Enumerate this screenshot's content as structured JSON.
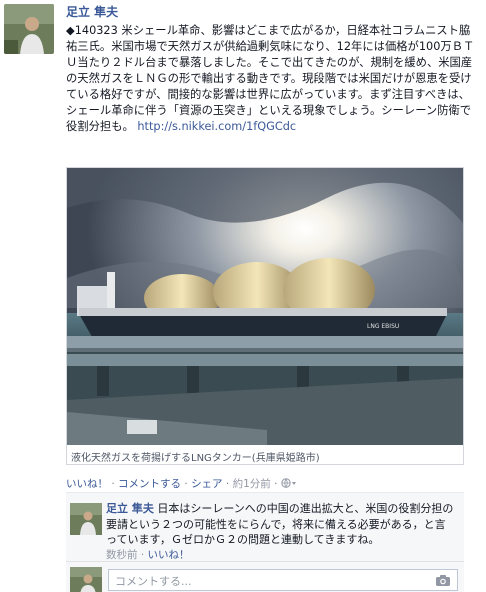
{
  "post": {
    "author": "足立 隼夫",
    "text": "◆140323 米シェール革命、影響はどこまで広がるか，日経本社コラムニスト脇祐三氏。米国市場で天然ガスが供給過剰気味になり、12年には価格が100万ＢＴＵ当たり２ドル台まで暴落しました。そこで出てきたのが、規制を緩め、米国産の天然ガスをＬＮＧの形で輸出する動きです。現段階では米国だけが恩恵を受けている格好ですが、間接的な影響は世界に広がっています。まず注目すべきは、シェール革命に伴う「資源の玉突き」といえる現象でしょう。シーレーン防衛で役割分担も。",
    "link": "http://s.nikkei.com/1fQGCdc",
    "photo_caption": "液化天然ガスを荷揚げするLNGタンカー(兵庫県姫路市)",
    "ship_name": "LNG EBISU"
  },
  "actions": {
    "like": "いいね！",
    "comment": "コメントする",
    "share": "シェア",
    "time": "約1分前",
    "separator": "·"
  },
  "comment": {
    "author": "足立 隼夫",
    "text": "日本はシーレーンへの中国の進出拡大と、米国の役割分担の要請という２つの可能性をにらんで，将来に備える必要がある，と言っています，ＧゼロかＧ２の問題と連動してきますね。",
    "time": "数秒前",
    "like": "いいね！"
  },
  "reply": {
    "placeholder": "コメントする..."
  },
  "colors": {
    "link": "#3b5998",
    "meta": "#9197a3",
    "comment_bg": "#f6f7f8"
  },
  "icons": [
    "globe-icon",
    "camera-icon"
  ]
}
